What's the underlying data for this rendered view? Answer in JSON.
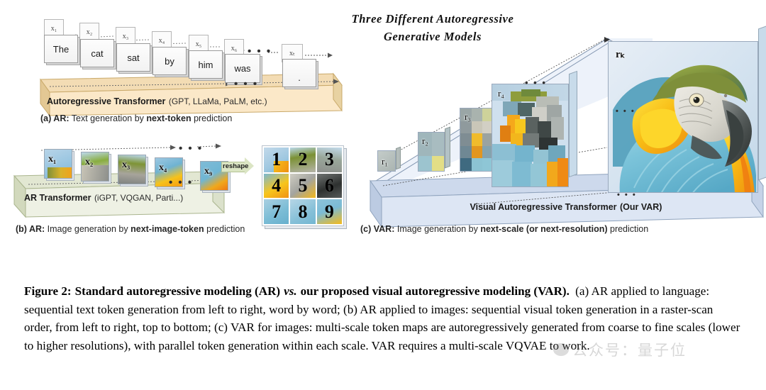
{
  "headline": {
    "line1": "Three  Different  Autoregressive",
    "line2": "Generative  Models"
  },
  "panel_a": {
    "tokens": [
      "The",
      "cat",
      "sat",
      "by",
      "him",
      "was",
      "."
    ],
    "x_labels": [
      "x₁",
      "x₂",
      "x₃",
      "x₄",
      "x₅",
      "x₆",
      "xₜ"
    ],
    "ellipsis": "• • •",
    "bar_title": "Autoregressive Transformer",
    "bar_sub": "(GPT, LLaMa, PaLM, etc.)",
    "caption_tag": "(a) AR:",
    "caption_pre": " Text generation by ",
    "caption_bold": "next-token",
    "caption_post": " prediction"
  },
  "panel_b": {
    "x_labels": [
      "x₁",
      "x₂",
      "x₃",
      "x₄",
      "x₉"
    ],
    "ellipsis": "• • •",
    "reshape_label": "reshape",
    "grid_numbers": [
      "1",
      "2",
      "3",
      "4",
      "5",
      "6",
      "7",
      "8",
      "9"
    ],
    "bar_title": "AR Transformer",
    "bar_sub": "(iGPT, VQGAN, Parti...)",
    "caption_tag": "(b) AR:",
    "caption_pre": " Image generation by ",
    "caption_bold": "next-image-token",
    "caption_post": " prediction"
  },
  "panel_c": {
    "scale_labels": [
      "r₁",
      "r₂",
      "r₃",
      "r₄",
      "rₖ"
    ],
    "ellipsis": "• • •",
    "bar_title": "Visual Autoregressive Transformer",
    "bar_sub": "(Our VAR)",
    "caption_tag": "(c) VAR:",
    "caption_pre": " Image generation by ",
    "caption_bold": "next-scale (or next-resolution)",
    "caption_post": " prediction"
  },
  "caption": {
    "figure_label": "Figure 2:",
    "bold_part_1": "Standard autoregressive modeling (AR)",
    "vs": "vs.",
    "bold_part_2": "our proposed visual autoregressive modeling (VAR).",
    "body": "(a) AR applied to language: sequential text token generation from left to right, word by word; (b) AR applied to images: sequential visual token generation in a raster-scan order, from left to right, top to bottom; (c) VAR for images: multi-scale token maps are autoregressively generated from coarse to fine scales (lower to higher resolutions), with parallel token generation within each scale. VAR requires a multi-scale VQVAE to work."
  },
  "watermark": {
    "text": "公众号：量子位"
  },
  "colors": {
    "bar_a": "#fbe8c8",
    "bar_b": "#eef1e4",
    "bar_c": "#dde6f4",
    "parrot_blue": "#6fc2dc",
    "parrot_gold": "#f5b820",
    "parrot_green": "#7e8f3a",
    "parrot_grey": "#9a9a98"
  }
}
